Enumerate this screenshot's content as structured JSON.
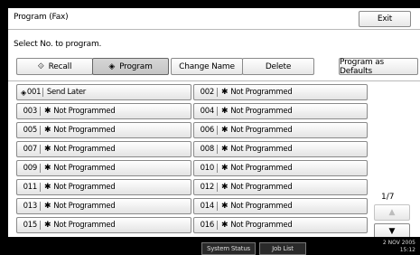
{
  "header": {
    "title": "Program (Fax)",
    "exit_label": "Exit"
  },
  "instruction": "Select No. to program.",
  "modes": {
    "recall_label": "Recall",
    "recall_icon": "recall-diamond-icon",
    "program_label": "Program",
    "program_icon": "program-diamond-icon",
    "selected": "Program"
  },
  "actions": {
    "change_name_label": "Change Name",
    "delete_label": "Delete",
    "defaults_label": "Program as Defaults"
  },
  "programs": [
    {
      "number": "001",
      "name": "Send Later",
      "programmed": true
    },
    {
      "number": "002",
      "name": "Not Programmed",
      "programmed": false
    },
    {
      "number": "003",
      "name": "Not Programmed",
      "programmed": false
    },
    {
      "number": "004",
      "name": "Not Programmed",
      "programmed": false
    },
    {
      "number": "005",
      "name": "Not Programmed",
      "programmed": false
    },
    {
      "number": "006",
      "name": "Not Programmed",
      "programmed": false
    },
    {
      "number": "007",
      "name": "Not Programmed",
      "programmed": false
    },
    {
      "number": "008",
      "name": "Not Programmed",
      "programmed": false
    },
    {
      "number": "009",
      "name": "Not Programmed",
      "programmed": false
    },
    {
      "number": "010",
      "name": "Not Programmed",
      "programmed": false
    },
    {
      "number": "011",
      "name": "Not Programmed",
      "programmed": false
    },
    {
      "number": "012",
      "name": "Not Programmed",
      "programmed": false
    },
    {
      "number": "013",
      "name": "Not Programmed",
      "programmed": false
    },
    {
      "number": "014",
      "name": "Not Programmed",
      "programmed": false
    },
    {
      "number": "015",
      "name": "Not Programmed",
      "programmed": false
    },
    {
      "number": "016",
      "name": "Not Programmed",
      "programmed": false
    }
  ],
  "pagination": {
    "indicator": "1/7",
    "up_icon": "triangle-up-icon",
    "down_icon": "triangle-down-icon",
    "up_enabled": false,
    "down_enabled": true
  },
  "status_bar": {
    "system_status_label": "System Status",
    "job_list_label": "Job List",
    "date": "2 NOV 2005",
    "time": "15:12"
  },
  "colors": {
    "background": "#000000",
    "panel": "#ffffff",
    "border": "#8a8a8a",
    "selected_mode": "#c4c4c4"
  }
}
